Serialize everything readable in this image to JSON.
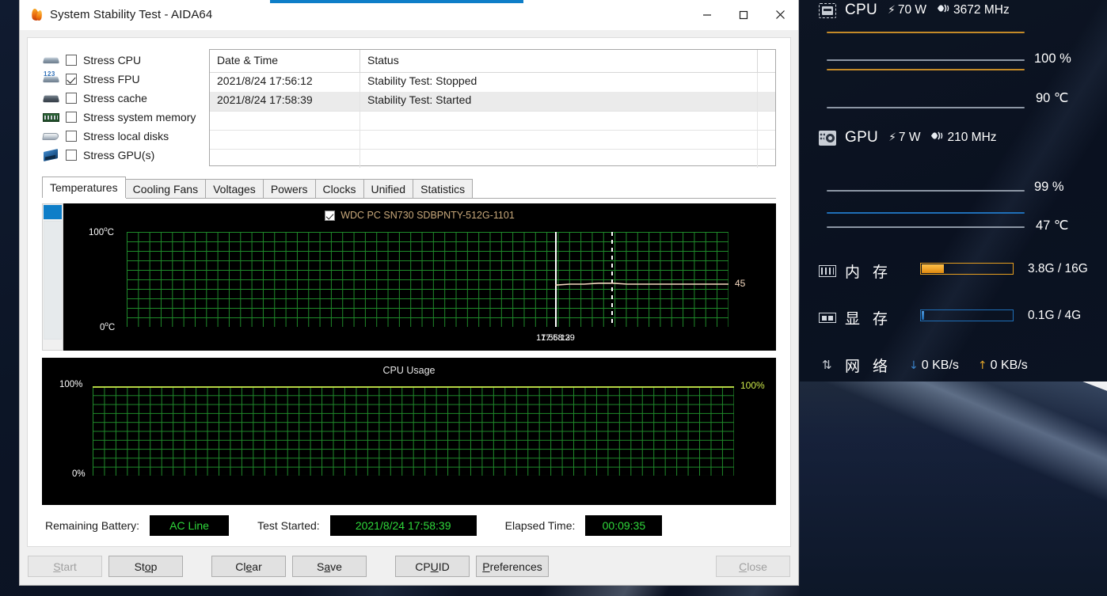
{
  "window": {
    "title": "System Stability Test - AIDA64",
    "icon": "flame-icon",
    "controls": {
      "minimize": "minimize-icon",
      "maximize": "maximize-icon",
      "close": "close-icon"
    }
  },
  "stress_options": [
    {
      "label": "Stress CPU",
      "checked": false,
      "icon": "cpu-chip-icon"
    },
    {
      "label": "Stress FPU",
      "checked": true,
      "icon": "fpu-chip-icon"
    },
    {
      "label": "Stress cache",
      "checked": false,
      "icon": "cache-chip-icon"
    },
    {
      "label": "Stress system memory",
      "checked": false,
      "icon": "memory-stick-icon"
    },
    {
      "label": "Stress local disks",
      "checked": false,
      "icon": "hard-disk-icon"
    },
    {
      "label": "Stress GPU(s)",
      "checked": false,
      "icon": "graphics-card-icon"
    }
  ],
  "log": {
    "columns": [
      "Date & Time",
      "Status"
    ],
    "rows": [
      {
        "datetime": "2021/8/24 17:56:12",
        "status": "Stability Test: Stopped"
      },
      {
        "datetime": "2021/8/24 17:58:39",
        "status": "Stability Test: Started"
      }
    ]
  },
  "tabs": [
    {
      "label": "Temperatures",
      "active": true
    },
    {
      "label": "Cooling Fans",
      "active": false
    },
    {
      "label": "Voltages",
      "active": false
    },
    {
      "label": "Powers",
      "active": false
    },
    {
      "label": "Clocks",
      "active": false
    },
    {
      "label": "Unified",
      "active": false
    },
    {
      "label": "Statistics",
      "active": false
    }
  ],
  "status": {
    "battery_label": "Remaining Battery:",
    "battery_value": "AC Line",
    "started_label": "Test Started:",
    "started_value": "2021/8/24 17:58:39",
    "elapsed_label": "Elapsed Time:",
    "elapsed_value": "00:09:35"
  },
  "buttons": {
    "start": "Start",
    "stop": "Stop",
    "clear": "Clear",
    "save": "Save",
    "cpuid": "CPUID",
    "preferences": "Preferences",
    "close": "Close"
  },
  "sensors": {
    "cpu": {
      "name": "CPU",
      "power": "70 W",
      "clock": "3672 MHz",
      "usage": "100 %",
      "temp": "90 ℃",
      "spark_color": "#c48a28",
      "line_color": "#9aa4b2"
    },
    "gpu": {
      "name": "GPU",
      "power": "7 W",
      "clock": "210 MHz",
      "usage": "99 %",
      "temp": "47 ℃",
      "spark_color": "#1f6fb8",
      "line_color": "#9aa4b2"
    },
    "memory": {
      "name": "内 存",
      "value": "3.8G / 16G",
      "percent": 24,
      "color": "#e8a020"
    },
    "vram": {
      "name": "显 存",
      "value": "0.1G / 4G",
      "percent": 3,
      "color": "#1f6fb8"
    },
    "network": {
      "name": "网 络",
      "download": "0 KB/s",
      "upload": "0 KB/s",
      "download_color": "#3b83c9",
      "upload_color": "#e0a32a"
    }
  },
  "chart_data": [
    {
      "type": "line",
      "id": "temperatures",
      "title": "",
      "legend": [
        "WDC PC SN730 SDBPNTY-512G-1101"
      ],
      "legend_checked": true,
      "legend_color": "#c8a87a",
      "ylabel_top": "100 °C",
      "ylabel_bottom": "0 °C",
      "ylim": [
        0,
        100
      ],
      "xlabels": [
        "17:56:12",
        "17:58:39"
      ],
      "grid": true,
      "grid_color": "#1f8a2a",
      "bg": "#000000",
      "series": [
        {
          "name": "WDC PC SN730 SDBPNTY-512G-1101",
          "color": "#f5d9c0",
          "current_value": 45,
          "label": "45",
          "values": [
            44,
            45,
            45,
            46,
            46,
            45,
            45,
            45,
            45,
            45,
            45,
            45,
            45
          ]
        }
      ],
      "markers": [
        {
          "x_label": "17:56:12",
          "style": "solid",
          "color": "#ffffff"
        },
        {
          "x_label": "17:58:39",
          "style": "dashed",
          "color": "#ffffff"
        }
      ]
    },
    {
      "type": "line",
      "id": "cpu-usage",
      "title": "CPU Usage",
      "ylabel_top": "100%",
      "ylabel_bottom": "0%",
      "ylim": [
        0,
        100
      ],
      "grid": true,
      "grid_color": "#1f8a2a",
      "bg": "#000000",
      "series": [
        {
          "name": "CPU Usage",
          "color": "#cde84a",
          "current_value": 100,
          "label": "100%",
          "values": [
            100,
            100,
            100,
            100,
            100,
            100,
            100,
            100,
            100,
            100,
            100,
            100
          ]
        }
      ]
    }
  ]
}
